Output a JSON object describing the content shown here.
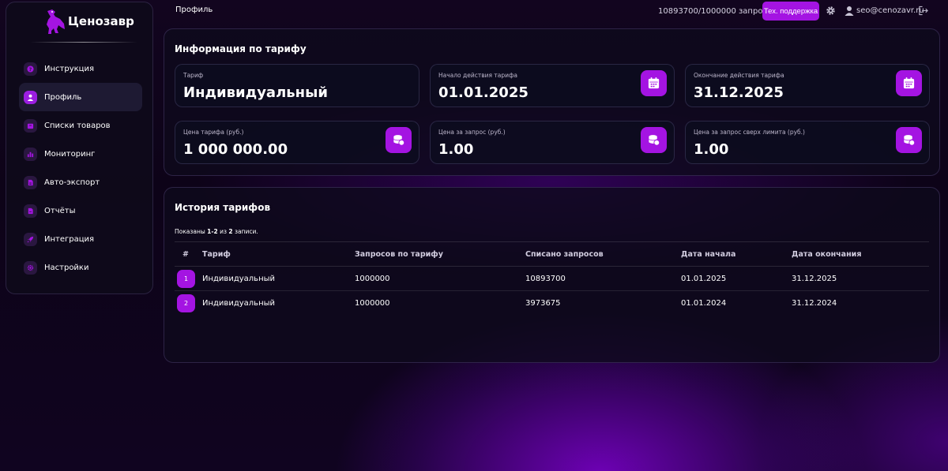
{
  "brand": {
    "name": "Ценозавр"
  },
  "sidebar": {
    "items": [
      {
        "label": "Инструкция",
        "icon": "question-icon"
      },
      {
        "label": "Профиль",
        "icon": "user-icon"
      },
      {
        "label": "Списки товаров",
        "icon": "box-icon"
      },
      {
        "label": "Мониторинг",
        "icon": "chart-icon"
      },
      {
        "label": "Авто-экспорт",
        "icon": "file-icon"
      },
      {
        "label": "Отчёты",
        "icon": "report-icon"
      },
      {
        "label": "Интеграция",
        "icon": "rocket-icon"
      },
      {
        "label": "Настройки",
        "icon": "gear-icon"
      }
    ],
    "active_index": 1
  },
  "topbar": {
    "breadcrumb": "Профиль",
    "requests": "10893700/1000000 запросов",
    "support_label": "Тех. поддержка",
    "user_email": "seo@cenozavr.ru"
  },
  "tariff_info": {
    "title": "Информация по тарифу",
    "cards": [
      {
        "label": "Тариф",
        "value": "Индивидуальный",
        "icon": "none"
      },
      {
        "label": "Начало действия тарифа",
        "value": "01.01.2025",
        "icon": "calendar-icon"
      },
      {
        "label": "Окончание действия тарифа",
        "value": "31.12.2025",
        "icon": "calendar-icon"
      },
      {
        "label": "Цена тарифа (руб.)",
        "value": "1 000 000.00",
        "icon": "coins-icon"
      },
      {
        "label": "Цена за запрос (руб.)",
        "value": "1.00",
        "icon": "coins-icon"
      },
      {
        "label": "Цена за запрос сверх лимита (руб.)",
        "value": "1.00",
        "icon": "coins-icon"
      }
    ]
  },
  "history": {
    "title": "История тарифов",
    "shown_prefix": "Показаны ",
    "shown_range": "1-2",
    "shown_mid": " из ",
    "shown_total": "2",
    "shown_suffix": " записи.",
    "columns": [
      "#",
      "Тариф",
      "Запросов по тарифу",
      "Списано запросов",
      "Дата начала",
      "Дата окончания"
    ],
    "rows": [
      {
        "num": "1",
        "tariff": "Индивидуальный",
        "requests": "1000000",
        "spent": "10893700",
        "start": "01.01.2025",
        "end": "31.12.2025"
      },
      {
        "num": "2",
        "tariff": "Индивидуальный",
        "requests": "1000000",
        "spent": "3973675",
        "start": "01.01.2024",
        "end": "31.12.2024"
      }
    ]
  },
  "colors": {
    "accent": "#a414e2",
    "background": "#0d0318"
  }
}
